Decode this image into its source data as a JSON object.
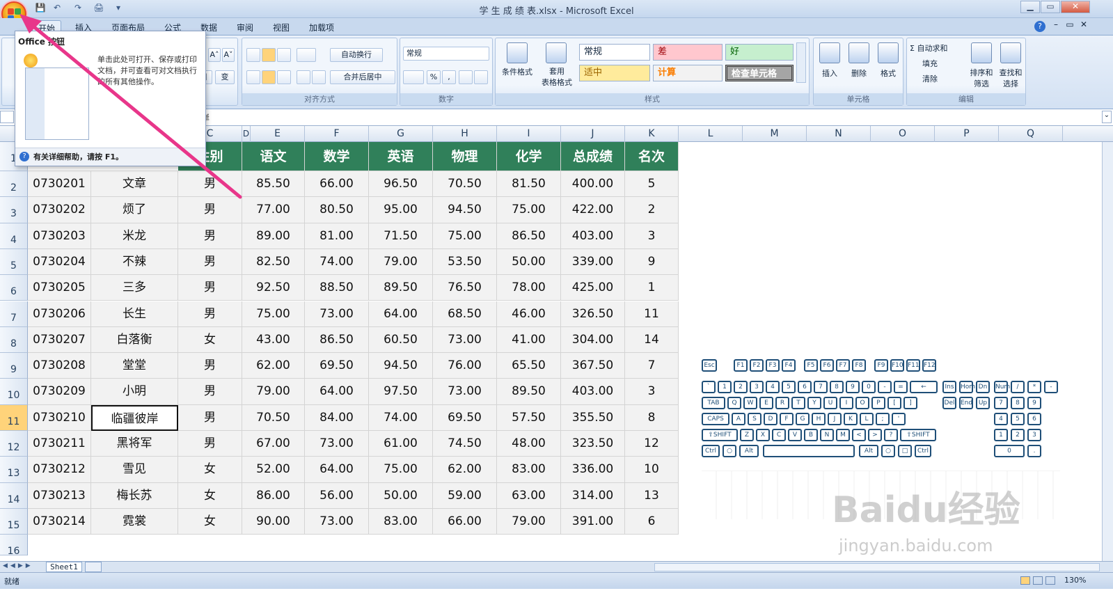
{
  "window": {
    "title": "学 生 成 绩 表.xlsx - Microsoft Excel",
    "minimize": "▁",
    "restore": "▭",
    "close": "✕",
    "sub_minimize": "–",
    "sub_restore": "▭",
    "sub_close": "✕",
    "help": "?"
  },
  "qat": {
    "save": "💾",
    "undo": "↶",
    "redo": "↷",
    "print": "🖨",
    "more": "▾"
  },
  "tabs": [
    "开始",
    "插入",
    "页面布局",
    "公式",
    "数据",
    "审阅",
    "视图",
    "加载项"
  ],
  "ribbon": {
    "font": {
      "grow": "A˄",
      "shrink": "A˅",
      "border": "田",
      "phonetic": "变"
    },
    "align": {
      "wrap": "自动换行",
      "merge": "合并后居中",
      "label": "对齐方式"
    },
    "number": {
      "format": "常规",
      "pct": "%",
      "comma": ",",
      "label": "数字"
    },
    "styles": {
      "cond_format": "条件格式",
      "table_format": "套用\n表格格式",
      "normal": "常规",
      "bad": "差",
      "good": "好",
      "neutral": "适中",
      "calc": "计算",
      "check": "检查单元格",
      "label": "样式"
    },
    "cells": {
      "insert": "插入",
      "delete": "删除",
      "format": "格式",
      "label": "单元格"
    },
    "edit": {
      "autosum": "Σ 自动求和",
      "fill": "填充",
      "clear": "清除",
      "sort": "排序和\n筛选",
      "find": "查找和\n选择",
      "label": "编辑"
    }
  },
  "popup": {
    "title": "Office 按钮",
    "desc": "单击此处可打开、保存或打印文档，并可查看可对文档执行的所有其他操作。",
    "footer": "有关详细帮助，请按 F1。"
  },
  "formula_bar": {
    "name_box": "",
    "content": "岸"
  },
  "columns": [
    "C",
    "D",
    "E",
    "F",
    "G",
    "H",
    "I",
    "J",
    "K",
    "L",
    "M",
    "N",
    "O",
    "P",
    "Q"
  ],
  "rows": [
    "1",
    "2",
    "3",
    "4",
    "5",
    "6",
    "7",
    "8",
    "9",
    "10",
    "11",
    "12",
    "13",
    "14",
    "15",
    "16"
  ],
  "table": {
    "headers": [
      "",
      "",
      "性别",
      "语文",
      "数学",
      "英语",
      "物理",
      "化学",
      "总成绩",
      "名次"
    ],
    "rows": [
      [
        "0730201",
        "文章",
        "男",
        "85.50",
        "66.00",
        "96.50",
        "70.50",
        "81.50",
        "400.00",
        "5"
      ],
      [
        "0730202",
        "烦了",
        "男",
        "77.00",
        "80.50",
        "95.00",
        "94.50",
        "75.00",
        "422.00",
        "2"
      ],
      [
        "0730203",
        "米龙",
        "男",
        "89.00",
        "81.00",
        "71.50",
        "75.00",
        "86.50",
        "403.00",
        "3"
      ],
      [
        "0730204",
        "不辣",
        "男",
        "82.50",
        "74.00",
        "79.00",
        "53.50",
        "50.00",
        "339.00",
        "9"
      ],
      [
        "0730205",
        "三多",
        "男",
        "92.50",
        "88.50",
        "89.50",
        "76.50",
        "78.00",
        "425.00",
        "1"
      ],
      [
        "0730206",
        "长生",
        "男",
        "75.00",
        "73.00",
        "64.00",
        "68.50",
        "46.00",
        "326.50",
        "11"
      ],
      [
        "0730207",
        "白落衡",
        "女",
        "43.00",
        "86.50",
        "60.50",
        "73.00",
        "41.00",
        "304.00",
        "14"
      ],
      [
        "0730208",
        "堂堂",
        "男",
        "62.00",
        "69.50",
        "94.50",
        "76.00",
        "65.50",
        "367.50",
        "7"
      ],
      [
        "0730209",
        "小明",
        "男",
        "79.00",
        "64.00",
        "97.50",
        "73.00",
        "89.50",
        "403.00",
        "3"
      ],
      [
        "0730210",
        "临疆彼岸",
        "男",
        "70.50",
        "84.00",
        "74.00",
        "69.50",
        "57.50",
        "355.50",
        "8"
      ],
      [
        "0730211",
        "黑将军",
        "男",
        "67.00",
        "73.00",
        "61.00",
        "74.50",
        "48.00",
        "323.50",
        "12"
      ],
      [
        "0730212",
        "雪见",
        "女",
        "52.00",
        "64.00",
        "75.00",
        "62.00",
        "83.00",
        "336.00",
        "10"
      ],
      [
        "0730213",
        "梅长苏",
        "女",
        "86.00",
        "56.00",
        "50.00",
        "59.00",
        "63.00",
        "314.00",
        "13"
      ],
      [
        "0730214",
        "霓裳",
        "女",
        "90.00",
        "73.00",
        "83.00",
        "66.00",
        "79.00",
        "391.00",
        "6"
      ]
    ]
  },
  "keyboard": {
    "row0": [
      "Esc",
      "F1",
      "F2",
      "F3",
      "F4",
      "F5",
      "F6",
      "F7",
      "F8",
      "F9",
      "F10",
      "F11",
      "F12"
    ],
    "row1": [
      "`",
      "1",
      "2",
      "3",
      "4",
      "5",
      "6",
      "7",
      "8",
      "9",
      "0",
      "-",
      "=",
      "←"
    ],
    "row2": [
      "TAB",
      "Q",
      "W",
      "E",
      "R",
      "T",
      "Y",
      "U",
      "I",
      "O",
      "P",
      "[",
      "]"
    ],
    "row3": [
      "CAPS",
      "A",
      "S",
      "D",
      "F",
      "G",
      "H",
      "J",
      "K",
      "L",
      ";",
      "'"
    ],
    "row4": [
      "⇧SHIFT",
      "Z",
      "X",
      "C",
      "V",
      "B",
      "N",
      "M",
      "<",
      ">",
      "?",
      "⇧SHIFT"
    ],
    "row5": [
      "Ctrl",
      "○",
      "Alt",
      "Alt",
      "○",
      "□",
      "Ctrl"
    ],
    "nav": [
      "Ins",
      "Hom",
      "Dn",
      "Del",
      "End",
      "Up"
    ],
    "num": [
      "Num",
      "/",
      "*",
      "-",
      "7",
      "8",
      "9",
      "4",
      "5",
      "6",
      "1",
      "2",
      "3",
      "0",
      "."
    ]
  },
  "sheet_tab": "Sheet1",
  "status": {
    "ready": "就绪",
    "zoom": "130%"
  },
  "watermark": {
    "main": "Baidu经验",
    "sub": "jingyan.baidu.com"
  }
}
